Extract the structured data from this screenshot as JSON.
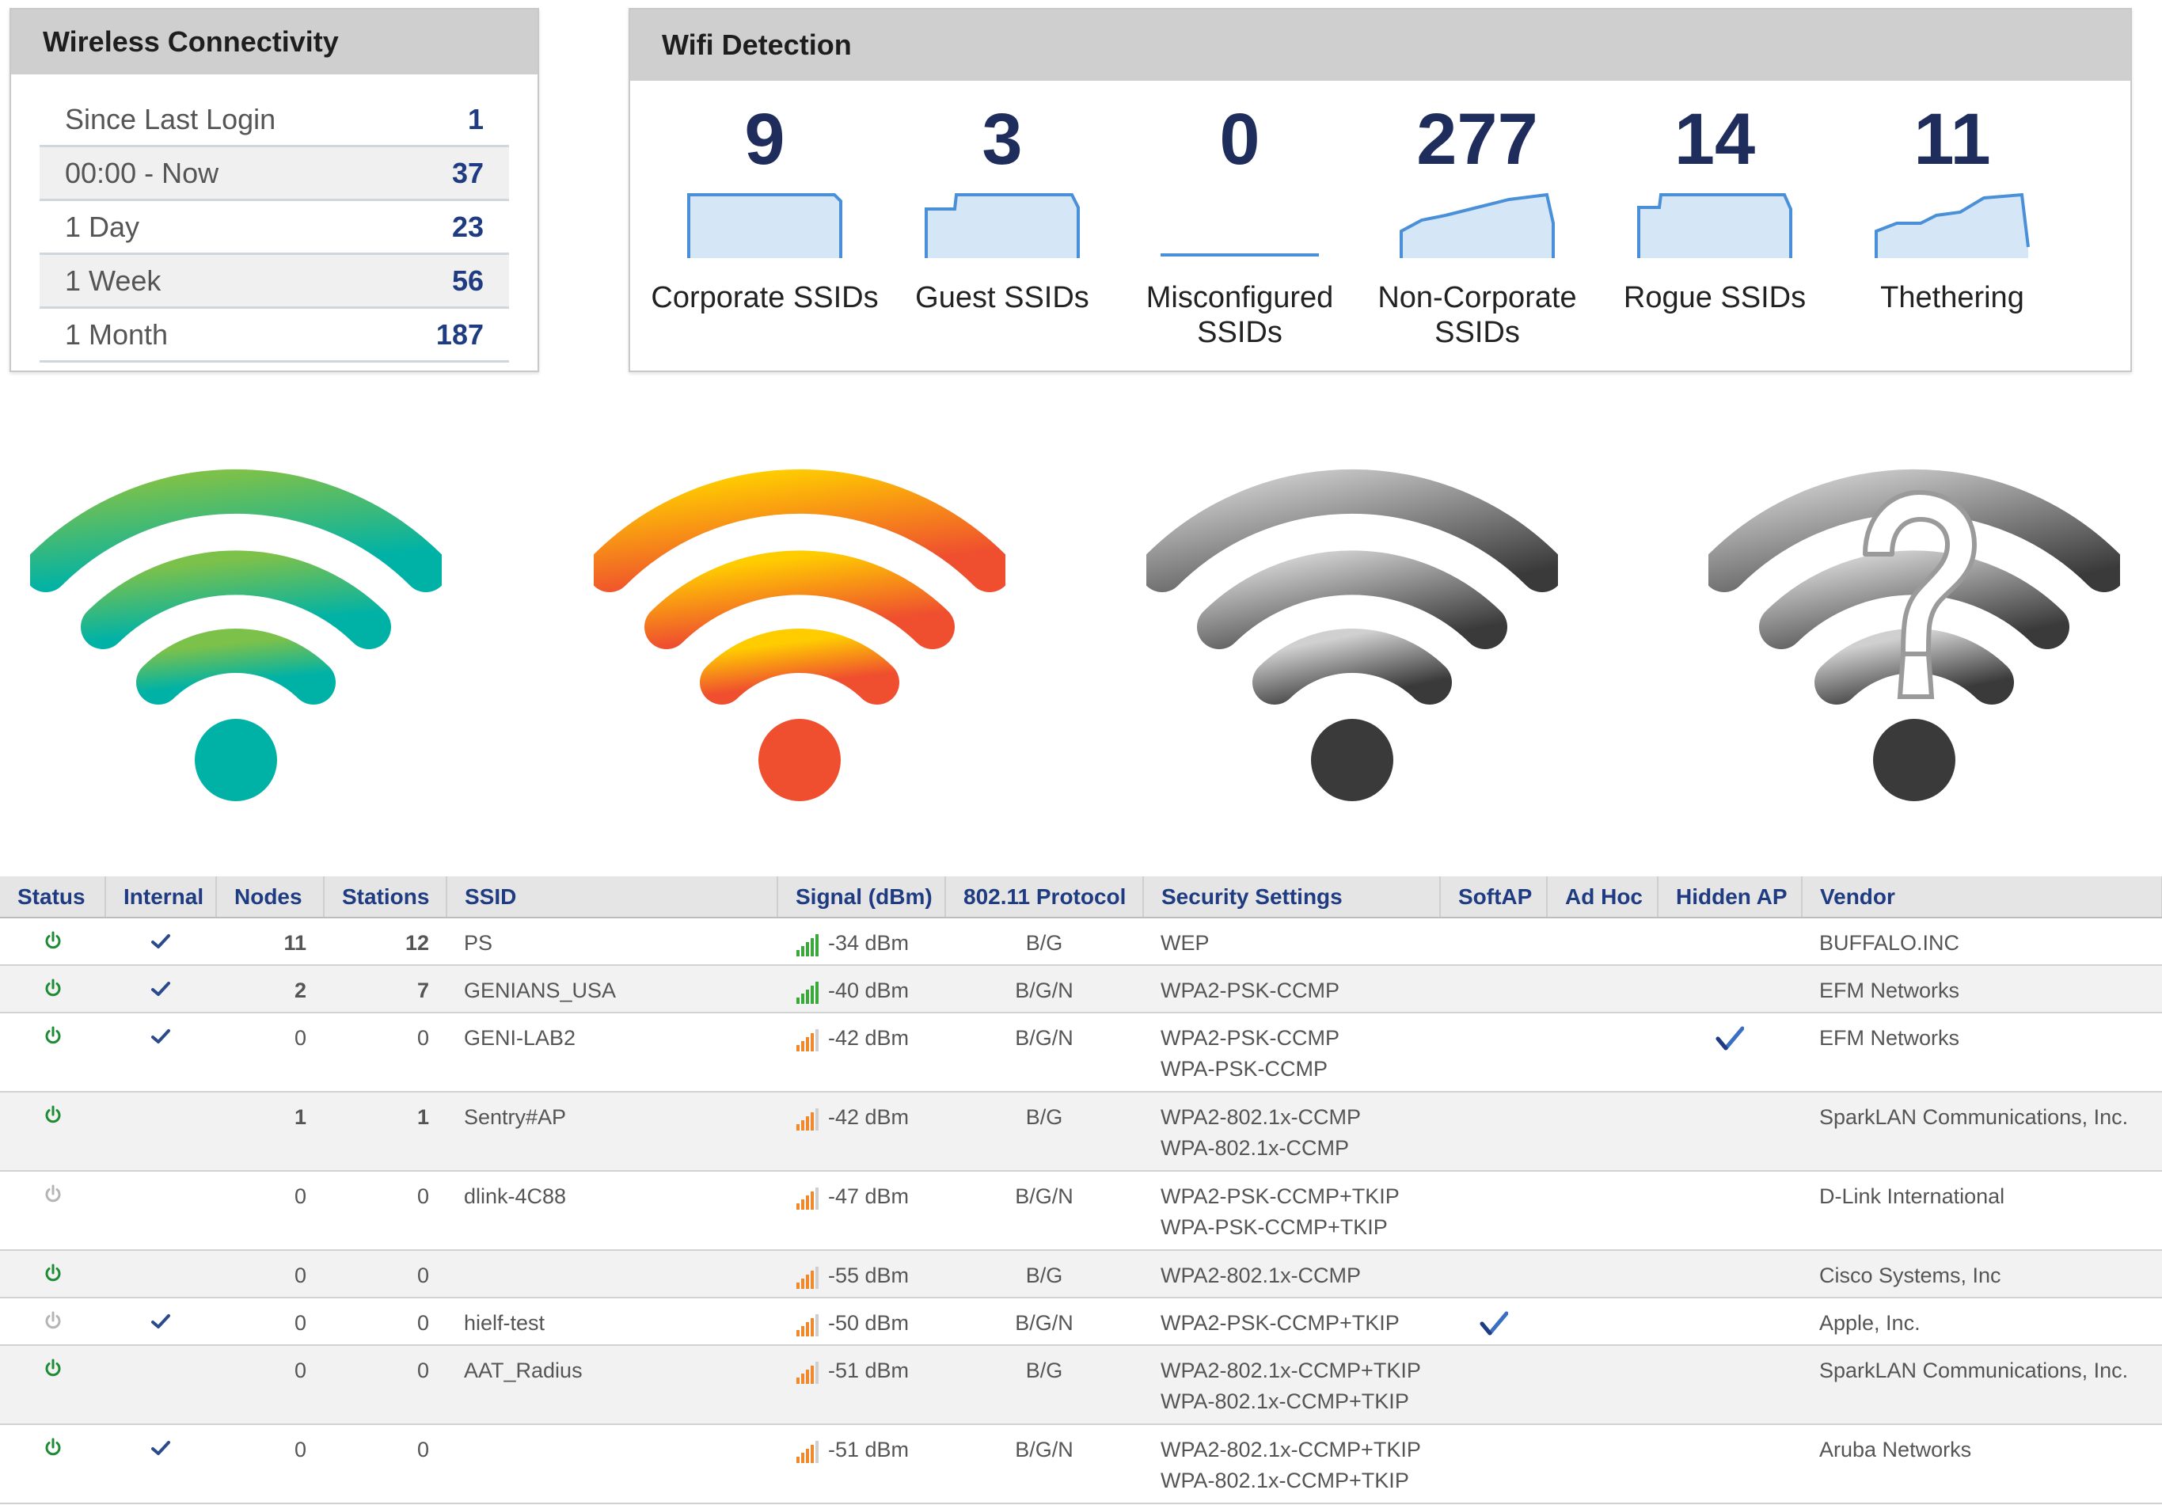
{
  "wireless_connectivity": {
    "title": "Wireless Connectivity",
    "rows": [
      {
        "label": "Since Last Login",
        "value": "1"
      },
      {
        "label": "00:00 - Now",
        "value": "37"
      },
      {
        "label": "1 Day",
        "value": "23"
      },
      {
        "label": "1 Week",
        "value": "56"
      },
      {
        "label": "1 Month",
        "value": "187"
      }
    ]
  },
  "wifi_detection": {
    "title": "Wifi Detection",
    "items": [
      {
        "count": "9",
        "label": "Corporate SSIDs"
      },
      {
        "count": "3",
        "label": "Guest SSIDs"
      },
      {
        "count": "0",
        "label": "Misconfigured SSIDs"
      },
      {
        "count": "277",
        "label": "Non-Corporate SSIDs"
      },
      {
        "count": "14",
        "label": "Rogue SSIDs"
      },
      {
        "count": "11",
        "label": "Thethering"
      }
    ]
  },
  "icons": [
    "wifi-green-icon",
    "wifi-orange-icon",
    "wifi-gray-icon",
    "wifi-unknown-icon"
  ],
  "colors": {
    "accent_blue": "#1f3b82",
    "status_on": "#1e8b35",
    "status_off": "#b5b5b5",
    "check": "#2b4a8a",
    "wifi_green": [
      "#7cc14a",
      "#00b2a6"
    ],
    "wifi_orange": [
      "#ffcc00",
      "#ef4e2f"
    ],
    "wifi_gray": [
      "#c4c4c4",
      "#3a3a3a"
    ]
  },
  "table": {
    "headers": {
      "status": "Status",
      "internal": "Internal",
      "nodes": "Nodes",
      "stations": "Stations",
      "ssid": "SSID",
      "signal": "Signal (dBm)",
      "protocol": "802.11 Protocol",
      "security": "Security Settings",
      "softap": "SoftAP",
      "adhoc": "Ad Hoc",
      "hidden": "Hidden AP",
      "vendor": "Vendor"
    },
    "rows": [
      {
        "status": "on",
        "internal": true,
        "nodes": "11",
        "stations": "12",
        "ssid": "PS",
        "signal": "-34 dBm",
        "bars": "green",
        "protocol": "B/G",
        "security": [
          "WEP"
        ],
        "softap": false,
        "adhoc": false,
        "hidden": false,
        "vendor": "BUFFALO.INC"
      },
      {
        "status": "on",
        "internal": true,
        "nodes": "2",
        "stations": "7",
        "ssid": "GENIANS_USA",
        "signal": "-40 dBm",
        "bars": "green",
        "protocol": "B/G/N",
        "security": [
          "WPA2-PSK-CCMP"
        ],
        "softap": false,
        "adhoc": false,
        "hidden": false,
        "vendor": "EFM Networks"
      },
      {
        "status": "on",
        "internal": true,
        "nodes": "0",
        "stations": "0",
        "ssid": "GENI-LAB2",
        "signal": "-42 dBm",
        "bars": "orange",
        "protocol": "B/G/N",
        "security": [
          "WPA2-PSK-CCMP",
          "WPA-PSK-CCMP"
        ],
        "softap": false,
        "adhoc": false,
        "hidden": true,
        "vendor": "EFM Networks"
      },
      {
        "status": "on",
        "internal": false,
        "nodes": "1",
        "stations": "1",
        "ssid": "Sentry#AP",
        "signal": "-42 dBm",
        "bars": "orange",
        "protocol": "B/G",
        "security": [
          "WPA2-802.1x-CCMP",
          "WPA-802.1x-CCMP"
        ],
        "softap": false,
        "adhoc": false,
        "hidden": false,
        "vendor": "SparkLAN Communications, Inc."
      },
      {
        "status": "off",
        "internal": false,
        "nodes": "0",
        "stations": "0",
        "ssid": "dlink-4C88",
        "signal": "-47 dBm",
        "bars": "orange",
        "protocol": "B/G/N",
        "security": [
          "WPA2-PSK-CCMP+TKIP",
          "WPA-PSK-CCMP+TKIP"
        ],
        "softap": false,
        "adhoc": false,
        "hidden": false,
        "vendor": "D-Link International"
      },
      {
        "status": "on",
        "internal": false,
        "nodes": "0",
        "stations": "0",
        "ssid": "",
        "signal": "-55 dBm",
        "bars": "orange",
        "protocol": "B/G",
        "security": [
          "WPA2-802.1x-CCMP"
        ],
        "softap": false,
        "adhoc": false,
        "hidden": false,
        "vendor": "Cisco Systems, Inc"
      },
      {
        "status": "off",
        "internal": true,
        "nodes": "0",
        "stations": "0",
        "ssid": "hielf-test",
        "signal": "-50 dBm",
        "bars": "orange",
        "protocol": "B/G/N",
        "security": [
          "WPA2-PSK-CCMP+TKIP"
        ],
        "softap": true,
        "adhoc": false,
        "hidden": false,
        "vendor": "Apple, Inc."
      },
      {
        "status": "on",
        "internal": false,
        "nodes": "0",
        "stations": "0",
        "ssid": "AAT_Radius",
        "signal": "-51 dBm",
        "bars": "orange",
        "protocol": "B/G",
        "security": [
          "WPA2-802.1x-CCMP+TKIP",
          "WPA-802.1x-CCMP+TKIP"
        ],
        "softap": false,
        "adhoc": false,
        "hidden": false,
        "vendor": "SparkLAN Communications, Inc."
      },
      {
        "status": "on",
        "internal": true,
        "nodes": "0",
        "stations": "0",
        "ssid": "",
        "signal": "-51 dBm",
        "bars": "orange",
        "protocol": "B/G/N",
        "security": [
          "WPA2-802.1x-CCMP+TKIP",
          "WPA-802.1x-CCMP+TKIP"
        ],
        "softap": false,
        "adhoc": false,
        "hidden": false,
        "vendor": "Aruba Networks"
      }
    ]
  }
}
